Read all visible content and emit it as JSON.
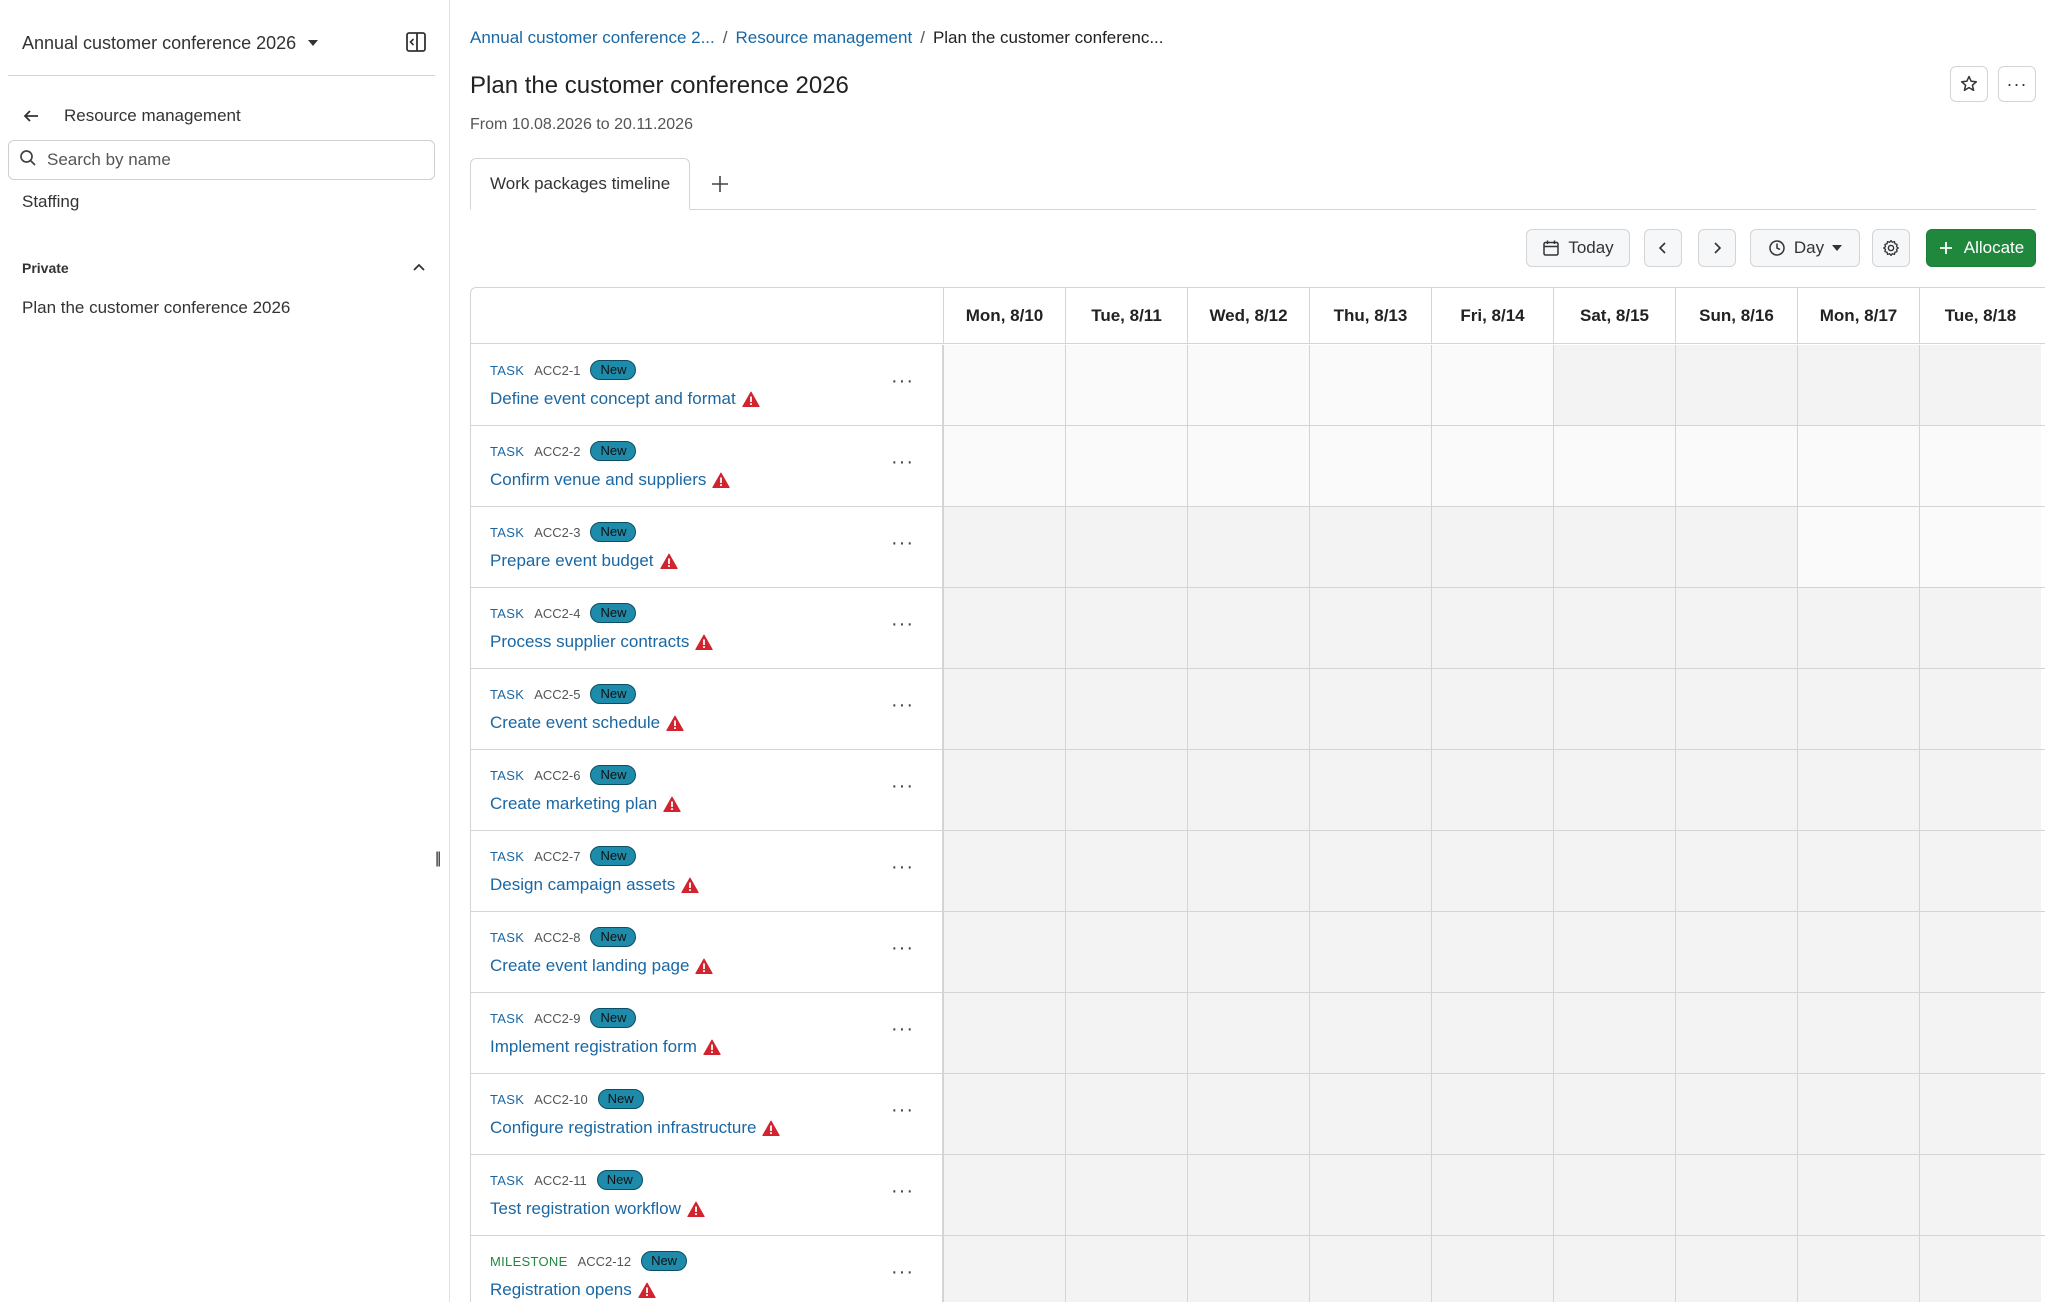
{
  "sidebar": {
    "project_name": "Annual customer conference 2026",
    "back_label": "Resource management",
    "search_placeholder": "Search by name",
    "staffing_label": "Staffing",
    "private_label": "Private",
    "private_item": "Plan the customer conference 2026"
  },
  "breadcrumb": {
    "project": "Annual customer conference 2...",
    "module": "Resource management",
    "current": "Plan the customer conferenc..."
  },
  "page": {
    "title": "Plan the customer conference 2026",
    "date_range": "From 10.08.2026 to 20.11.2026"
  },
  "tabs": {
    "timeline": "Work packages timeline"
  },
  "toolbar": {
    "today": "Today",
    "scale": "Day",
    "allocate": "Allocate"
  },
  "days": [
    "Mon, 8/10",
    "Tue, 8/11",
    "Wed, 8/12",
    "Thu, 8/13",
    "Fri, 8/14",
    "Sat, 8/15",
    "Sun, 8/16",
    "Mon, 8/17",
    "Tue, 8/18"
  ],
  "work_packages": [
    {
      "type": "TASK",
      "id": "ACC2-1",
      "status": "New",
      "title": "Define event concept and format",
      "available_days": [
        0,
        1,
        2,
        3,
        4
      ]
    },
    {
      "type": "TASK",
      "id": "ACC2-2",
      "status": "New",
      "title": "Confirm venue and suppliers",
      "available_days": [
        0,
        1,
        2,
        3,
        4,
        5,
        6,
        7,
        8
      ]
    },
    {
      "type": "TASK",
      "id": "ACC2-3",
      "status": "New",
      "title": "Prepare event budget",
      "available_days": [
        7,
        8
      ]
    },
    {
      "type": "TASK",
      "id": "ACC2-4",
      "status": "New",
      "title": "Process supplier contracts",
      "available_days": []
    },
    {
      "type": "TASK",
      "id": "ACC2-5",
      "status": "New",
      "title": "Create event schedule",
      "available_days": []
    },
    {
      "type": "TASK",
      "id": "ACC2-6",
      "status": "New",
      "title": "Create marketing plan",
      "available_days": []
    },
    {
      "type": "TASK",
      "id": "ACC2-7",
      "status": "New",
      "title": "Design campaign assets",
      "available_days": []
    },
    {
      "type": "TASK",
      "id": "ACC2-8",
      "status": "New",
      "title": "Create event landing page",
      "available_days": []
    },
    {
      "type": "TASK",
      "id": "ACC2-9",
      "status": "New",
      "title": "Implement registration form",
      "available_days": []
    },
    {
      "type": "TASK",
      "id": "ACC2-10",
      "status": "New",
      "title": "Configure registration infrastructure",
      "available_days": []
    },
    {
      "type": "TASK",
      "id": "ACC2-11",
      "status": "New",
      "title": "Test registration workflow",
      "available_days": []
    },
    {
      "type": "MILESTONE",
      "id": "ACC2-12",
      "status": "New",
      "title": "Registration opens",
      "available_days": []
    }
  ],
  "colors": {
    "link": "#1a67a3",
    "milestone": "#1f883d",
    "badge": "#1e8bab",
    "warning": "#d1242f",
    "allocate": "#1f883d"
  }
}
